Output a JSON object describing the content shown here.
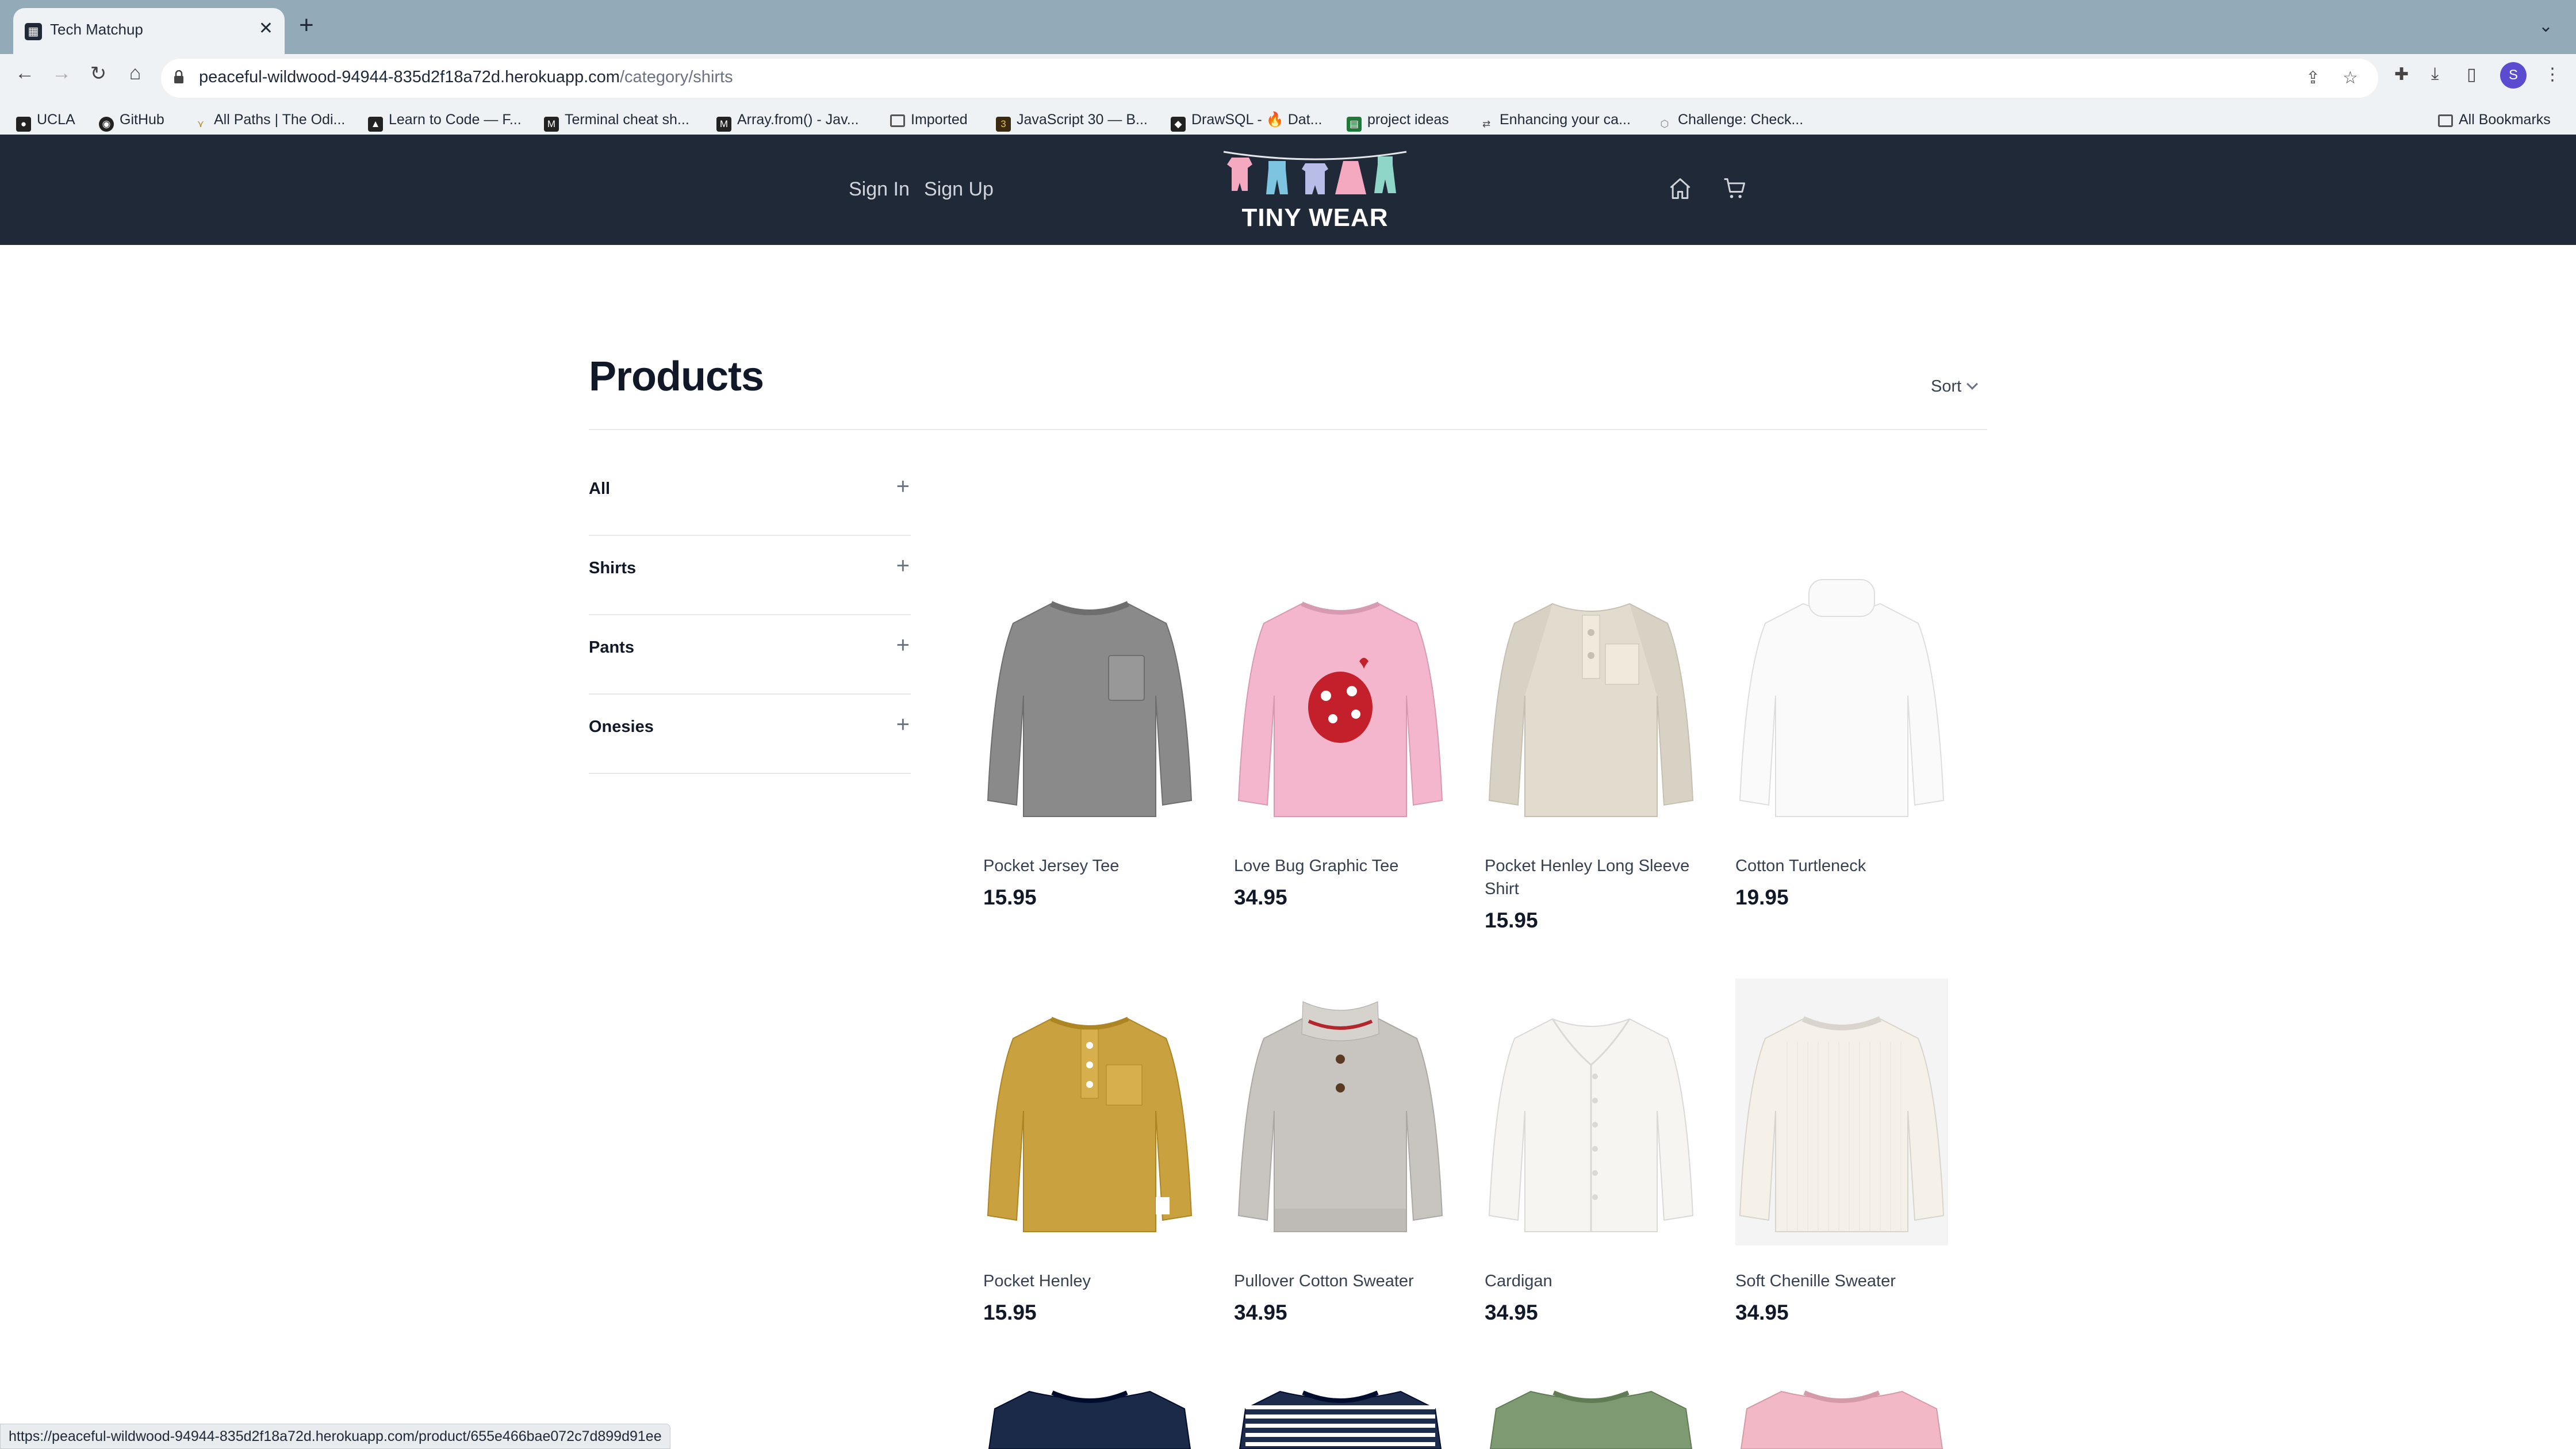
{
  "browser": {
    "tab_title": "Tech Matchup",
    "url_host": "peaceful-wildwood-94944-835d2f18a72d.herokuapp.com",
    "url_path": "/category/shirts",
    "avatar_letter": "S",
    "bookmarks": [
      {
        "label": "UCLA",
        "icon": "ucla-icon"
      },
      {
        "label": "GitHub",
        "icon": "github-icon"
      },
      {
        "label": "All Paths | The Odi...",
        "icon": "odin-icon"
      },
      {
        "label": "Learn to Code — F...",
        "icon": "fcc-icon"
      },
      {
        "label": "Terminal cheat sh...",
        "icon": "m-icon"
      },
      {
        "label": "Array.from() - Jav...",
        "icon": "m-icon"
      },
      {
        "label": "Imported",
        "icon": "folder-icon"
      },
      {
        "label": "JavaScript 30 — B...",
        "icon": "js30-icon"
      },
      {
        "label": "DrawSQL - 🔥 Dat...",
        "icon": "drawsql-icon"
      },
      {
        "label": "project ideas",
        "icon": "doc-icon"
      },
      {
        "label": "Enhancing your ca...",
        "icon": "link-icon"
      },
      {
        "label": "Challenge: Check...",
        "icon": "cube-icon"
      }
    ],
    "all_bookmarks": "All Bookmarks",
    "status_url": "https://peaceful-wildwood-94944-835d2f18a72d.herokuapp.com/product/655e466bae072c7d899d91ee"
  },
  "header": {
    "sign_in": "Sign In",
    "sign_up": "Sign Up",
    "logo_text": "TINY WEAR",
    "bg_color": "#1f2937"
  },
  "main": {
    "title": "Products",
    "sort_label": "Sort",
    "filters": [
      {
        "label": "All"
      },
      {
        "label": "Shirts"
      },
      {
        "label": "Pants"
      },
      {
        "label": "Onesies"
      }
    ],
    "products": [
      {
        "name": "Pocket Jersey Tee",
        "price": "15.95",
        "color": "#8a8a8a",
        "kind": "tee-pocket"
      },
      {
        "name": "Love Bug Graphic Tee",
        "price": "34.95",
        "color": "#f4b6cc",
        "kind": "tee-graphic"
      },
      {
        "name": "Pocket Henley Long Sleeve Shirt",
        "price": "15.95",
        "color": "#e2dccf",
        "kind": "henley-raglan"
      },
      {
        "name": "Cotton Turtleneck",
        "price": "19.95",
        "color": "#fafafa",
        "kind": "turtleneck"
      },
      {
        "name": "Pocket Henley",
        "price": "15.95",
        "color": "#c9a13f",
        "kind": "henley"
      },
      {
        "name": "Pullover Cotton Sweater",
        "price": "34.95",
        "color": "#c8c5c1",
        "kind": "sweater-zip"
      },
      {
        "name": "Cardigan",
        "price": "34.95",
        "color": "#f6f5f1",
        "kind": "cardigan"
      },
      {
        "name": "Soft Chenille Sweater",
        "price": "34.95",
        "color": "#f5f1e8",
        "kind": "sweater"
      }
    ],
    "partial_products": [
      {
        "color": "#1c2a4a"
      },
      {
        "color": "#1d2b4d"
      },
      {
        "color": "#7e9a72"
      },
      {
        "color": "#f2b8c6"
      }
    ]
  }
}
